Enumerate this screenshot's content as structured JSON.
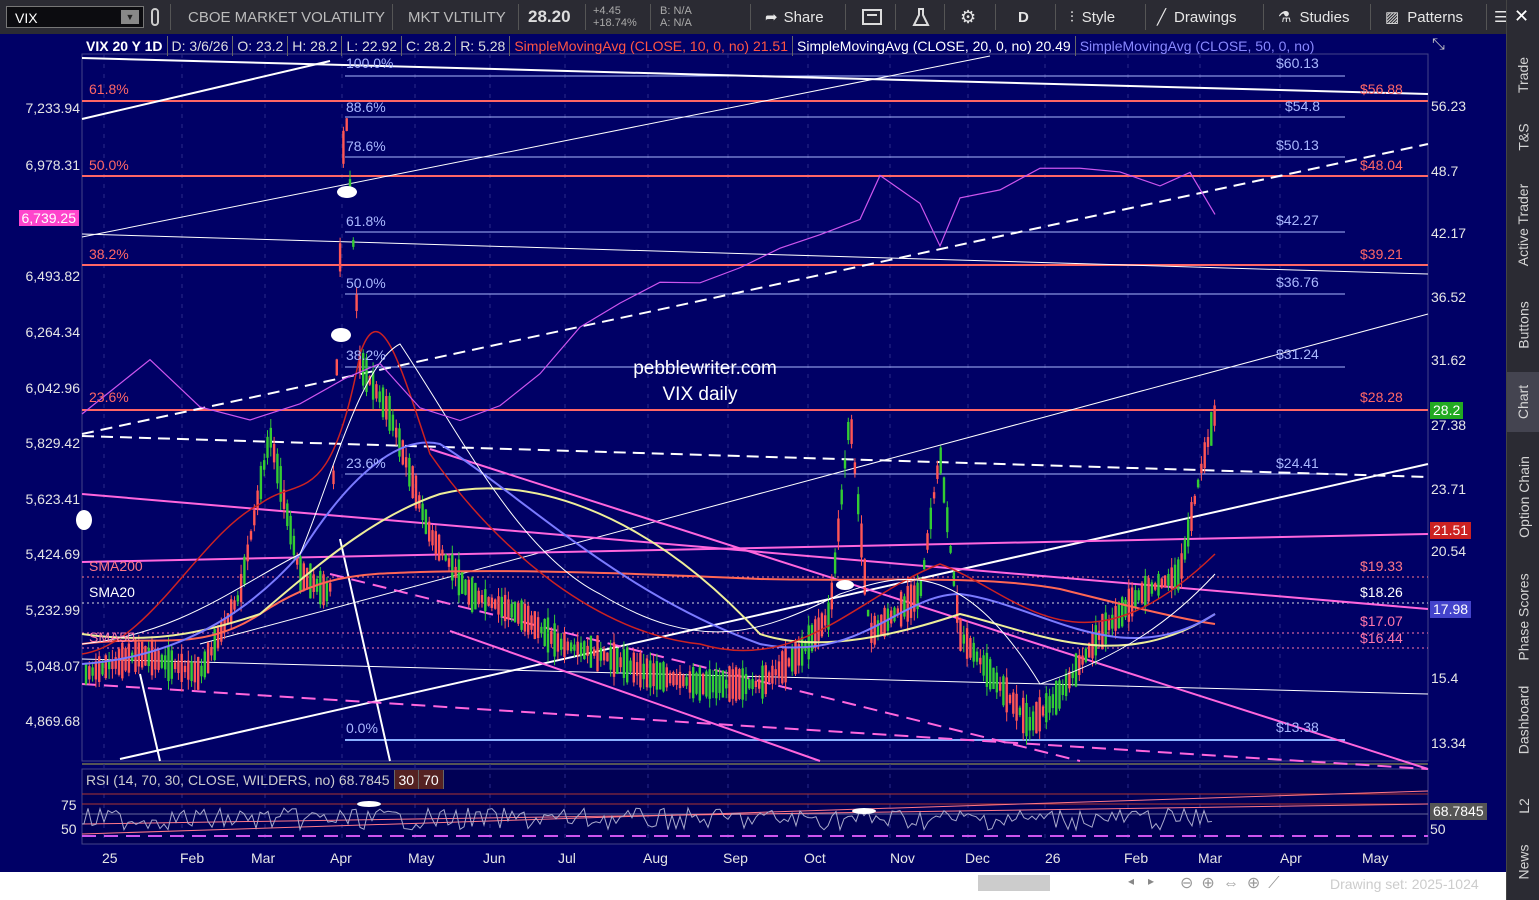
{
  "toolbar": {
    "symbol": "VIX",
    "desc": "CBOE MARKET VOLATILITY",
    "short": "MKT VLTILITY",
    "last": "28.20",
    "change": "+4.45",
    "change_pct": "+18.74%",
    "bid": "B: N/A",
    "ask": "A: N/A",
    "share": "Share",
    "period": "D",
    "style": "Style",
    "drawings": "Drawings",
    "studies": "Studies",
    "patterns": "Patterns"
  },
  "header": {
    "study": "VIX 20 Y 1D",
    "date": "D: 3/6/26",
    "open": "O: 23.2",
    "high": "H: 28.2",
    "low": "L: 22.92",
    "close": "C: 28.2",
    "range": "R: 5.28",
    "sma10": "SimpleMovingAvg (CLOSE, 10, 0, no)",
    "sma10_val": "21.51",
    "sma20": "SimpleMovingAvg (CLOSE, 20, 0, no)",
    "sma20_val": "20.49",
    "sma50": "SimpleMovingAvg (CLOSE, 50, 0, no)"
  },
  "annotation": {
    "line1": "pebblewriter.com",
    "line2": "VIX daily"
  },
  "left_axis": [
    "7,233.94",
    "6,978.31",
    "6,739.25",
    "6,493.82",
    "6,264.34",
    "6,042.96",
    "5,829.42",
    "5,623.41",
    "5,424.69",
    "5,232.99",
    "5,048.07",
    "4,869.68"
  ],
  "left_highlight": "6,739.25",
  "right_axis": [
    "56.23",
    "48.7",
    "42.17",
    "36.52",
    "31.62",
    "27.38",
    "23.71",
    "20.54",
    "15.4",
    "13.34"
  ],
  "price_tags": {
    "last": "28.2",
    "sma10": "21.51",
    "sma50": "17.98"
  },
  "fib_blue": [
    {
      "pct": "100.0%",
      "val": "$60.13"
    },
    {
      "pct": "88.6%",
      "val": "$54.8"
    },
    {
      "pct": "78.6%",
      "val": "$50.13"
    },
    {
      "pct": "61.8%",
      "val": "$42.27"
    },
    {
      "pct": "50.0%",
      "val": "$36.76"
    },
    {
      "pct": "38.2%",
      "val": "$31.24"
    },
    {
      "pct": "23.6%",
      "val": "$24.41"
    },
    {
      "pct": "0.0%",
      "val": "$13.38"
    }
  ],
  "fib_red": [
    {
      "pct": "61.8%",
      "val": "$56.88"
    },
    {
      "pct": "50.0%",
      "val": "$48.04"
    },
    {
      "pct": "38.2%",
      "val": "$39.21"
    },
    {
      "pct": "23.6%",
      "val": "$28.28"
    }
  ],
  "sma_labels": {
    "sma200": "SMA200",
    "sma20": "SMA20",
    "sma50": "SMA50",
    "v1933": "$19.33",
    "v1826": "$18.26",
    "v1707": "$17.07",
    "v1644": "$16.44"
  },
  "rsi": {
    "label": "RSI (14, 70, 30, CLOSE, WILDERS, no)",
    "value": "68.7845",
    "lo": "30",
    "hi": "70",
    "tick75": "75",
    "tick50": "50",
    "val_tag": "68.7845",
    "r50": "50"
  },
  "months": [
    "25",
    "Feb",
    "Mar",
    "Apr",
    "May",
    "Jun",
    "Jul",
    "Aug",
    "Sep",
    "Oct",
    "Nov",
    "Dec",
    "26",
    "Feb",
    "Mar",
    "Apr",
    "May"
  ],
  "side_tabs": [
    "Trade",
    "T&S",
    "Active Trader",
    "Buttons",
    "Chart",
    "Option Chain",
    "Phase Scores",
    "Dashboard",
    "L2",
    "News"
  ],
  "drawing_set": "Drawing set: 2025-1024"
}
